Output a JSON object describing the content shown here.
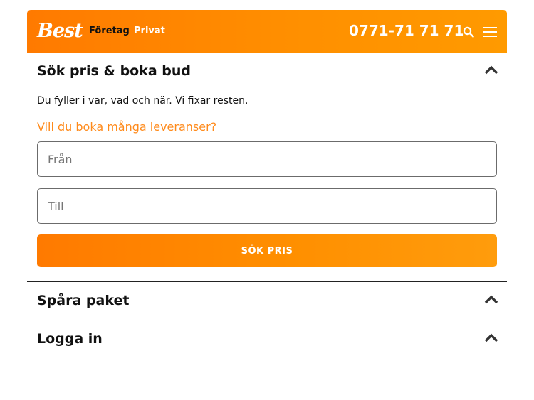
{
  "header": {
    "logo": "Best",
    "nav": {
      "foretag": "Företag",
      "privat": "Privat"
    },
    "phone": "0771-71 71 71",
    "icons": {
      "search": "search-icon",
      "menu": "menu-icon"
    }
  },
  "booking": {
    "title": "Sök pris & boka bud",
    "intro": "Du fyller i var, vad och när. Vi fixar resten.",
    "bulk_link": "Vill du boka många leveranser?",
    "from_placeholder": "Från",
    "to_placeholder": "Till",
    "cta_label": "SÖK PRIS"
  },
  "track": {
    "title": "Spåra paket"
  },
  "login": {
    "title": "Logga in"
  },
  "colors": {
    "accent": "#ff8a00",
    "link": "#ff8a1a",
    "text": "#111111"
  }
}
